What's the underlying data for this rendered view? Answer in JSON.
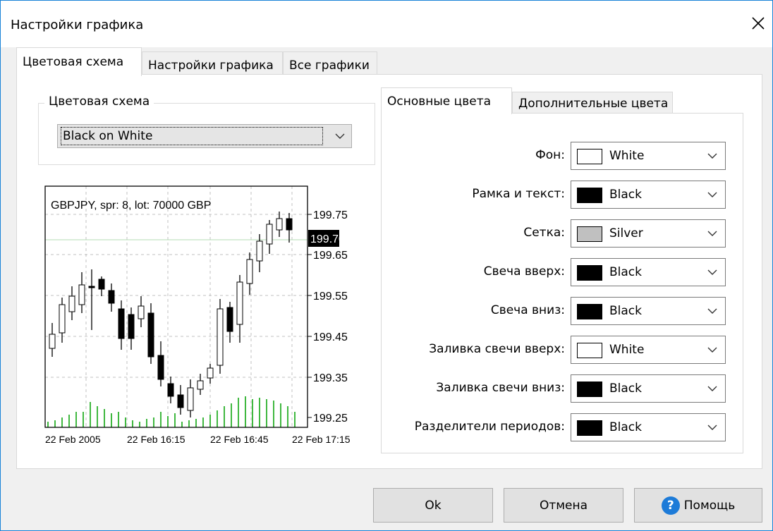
{
  "window": {
    "title": "Настройки графика"
  },
  "tabs": [
    {
      "label": "Цветовая схема",
      "active": true
    },
    {
      "label": "Настройки графика",
      "active": false
    },
    {
      "label": "Все графики",
      "active": false
    }
  ],
  "scheme_group": {
    "label": "Цветовая схема",
    "selected": "Black on White"
  },
  "chart_preview": {
    "header": "GBPJPY, spr: 8, lot: 70000 GBP",
    "price_labels": [
      "199.75",
      "199.65",
      "199.55",
      "199.45",
      "199.35",
      "199.25"
    ],
    "current_price": "199.70",
    "time_labels": [
      "22 Feb 2005",
      "22 Feb 16:15",
      "22 Feb 16:45",
      "22 Feb 17:15"
    ]
  },
  "color_tabs": [
    {
      "label": "Основные цвета",
      "active": true
    },
    {
      "label": "Дополнительные цвета",
      "active": false
    }
  ],
  "color_rows": [
    {
      "label": "Фон:",
      "value": "White",
      "swatch": "#ffffff"
    },
    {
      "label": "Рамка и текст:",
      "value": "Black",
      "swatch": "#000000"
    },
    {
      "label": "Сетка:",
      "value": "Silver",
      "swatch": "#c0c0c0"
    },
    {
      "label": "Свеча вверх:",
      "value": "Black",
      "swatch": "#000000"
    },
    {
      "label": "Свеча вниз:",
      "value": "Black",
      "swatch": "#000000"
    },
    {
      "label": "Заливка свечи вверх:",
      "value": "White",
      "swatch": "#ffffff"
    },
    {
      "label": "Заливка свечи вниз:",
      "value": "Black",
      "swatch": "#000000"
    },
    {
      "label": "Разделители периодов:",
      "value": "Black",
      "swatch": "#000000"
    }
  ],
  "buttons": {
    "ok": "Ok",
    "cancel": "Отмена",
    "help": "Помощь"
  },
  "colors": {
    "accent": "#1d7bd8",
    "volume": "#00a000",
    "grid": "#c0c0c0",
    "current_line": "#b4dcb4"
  }
}
